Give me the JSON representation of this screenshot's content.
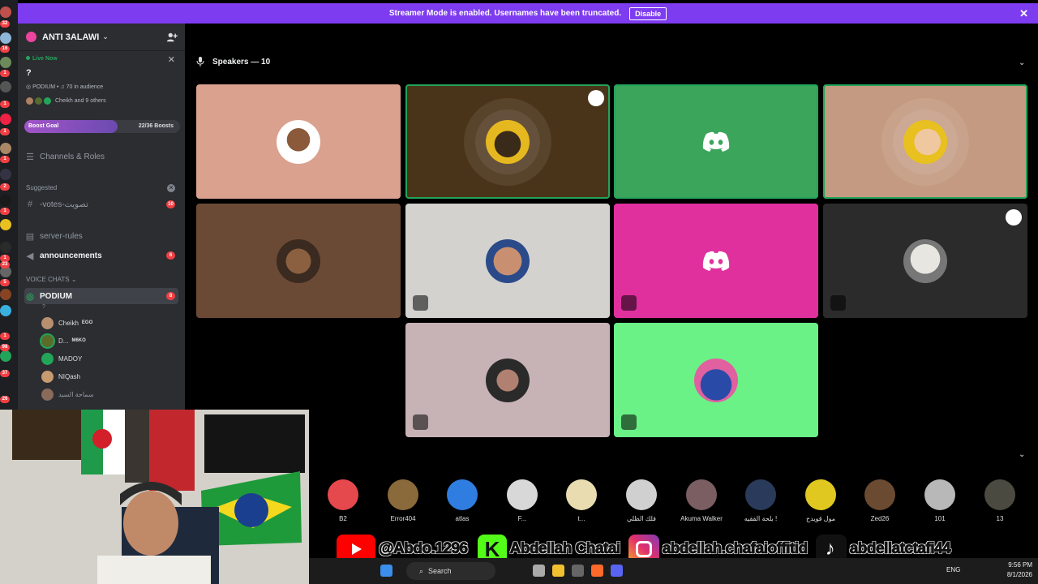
{
  "banner": {
    "message": "Streamer Mode is enabled. Usernames have been truncated.",
    "disable_label": "Disable"
  },
  "rail": {
    "badges": [
      "32",
      "16",
      "1",
      "1",
      "1",
      "1",
      "2",
      "1",
      "1",
      "5",
      "23",
      "1",
      "98",
      "37",
      "26"
    ]
  },
  "sidebar": {
    "server_name": "ANTI 3ALAWI",
    "live": {
      "status": "Live Now",
      "title": "?",
      "stage": "PODIUM",
      "audience": "70 in audience",
      "who": "Cheikh and 9 others"
    },
    "boost": {
      "label": "Boost Goal",
      "count": "22/36 Boosts"
    },
    "channels_roles": "Channels & Roles",
    "suggested_label": "Suggested",
    "votes_channel": "-votes-تصويت",
    "votes_badge": "10",
    "server_rules": "server-rules",
    "announcements": "announcements",
    "announcements_badge": "6",
    "voice_label": "VOICE CHATS",
    "podium": "PODIUM",
    "podium_badge": "8",
    "podium_sub": "?",
    "members": [
      {
        "name": "Cheikh",
        "tag": "EGO"
      },
      {
        "name": "D...",
        "tag": "M6KO"
      },
      {
        "name": "MADOY",
        "tag": ""
      },
      {
        "name": "NIQash",
        "tag": ""
      },
      {
        "name": "سماحة السيد",
        "tag": ""
      }
    ]
  },
  "stage": {
    "speakers_label": "Speakers — 10"
  },
  "audience": [
    {
      "name": "B2",
      "color": "#e5484d"
    },
    {
      "name": "Error404",
      "color": "#8a6a3a"
    },
    {
      "name": "atlas",
      "color": "#2f7de1"
    },
    {
      "name": "F...",
      "color": "#d8d8d8"
    },
    {
      "name": "t...",
      "color": "#e8dcb0"
    },
    {
      "name": "فلك الظلي",
      "color": "#d0d0d0"
    },
    {
      "name": "Akuma Walker",
      "color": "#7a5e62"
    },
    {
      "name": "بلحة الفقيه !",
      "color": "#2a3a5a"
    },
    {
      "name": "مول قويدح",
      "color": "#e0c820"
    },
    {
      "name": "Zed26",
      "color": "#6b4a32"
    },
    {
      "name": "101",
      "color": "#b8b8b8"
    },
    {
      "name": "13",
      "color": "#4a4a40"
    }
  ],
  "socials": {
    "youtube": "@Abdo.1296",
    "kick": "Abdellah Chatai",
    "instagram": "abdellah.chafaioffitid",
    "tiktok": "abdellatctafi44"
  },
  "taskbar": {
    "search": "Search",
    "lang": "ENG",
    "time": "9:56 PM",
    "date": "8/1/2026"
  },
  "colors": {
    "accent": "#7e3cf0",
    "speaking": "#23a559",
    "badge": "#f23f43"
  }
}
